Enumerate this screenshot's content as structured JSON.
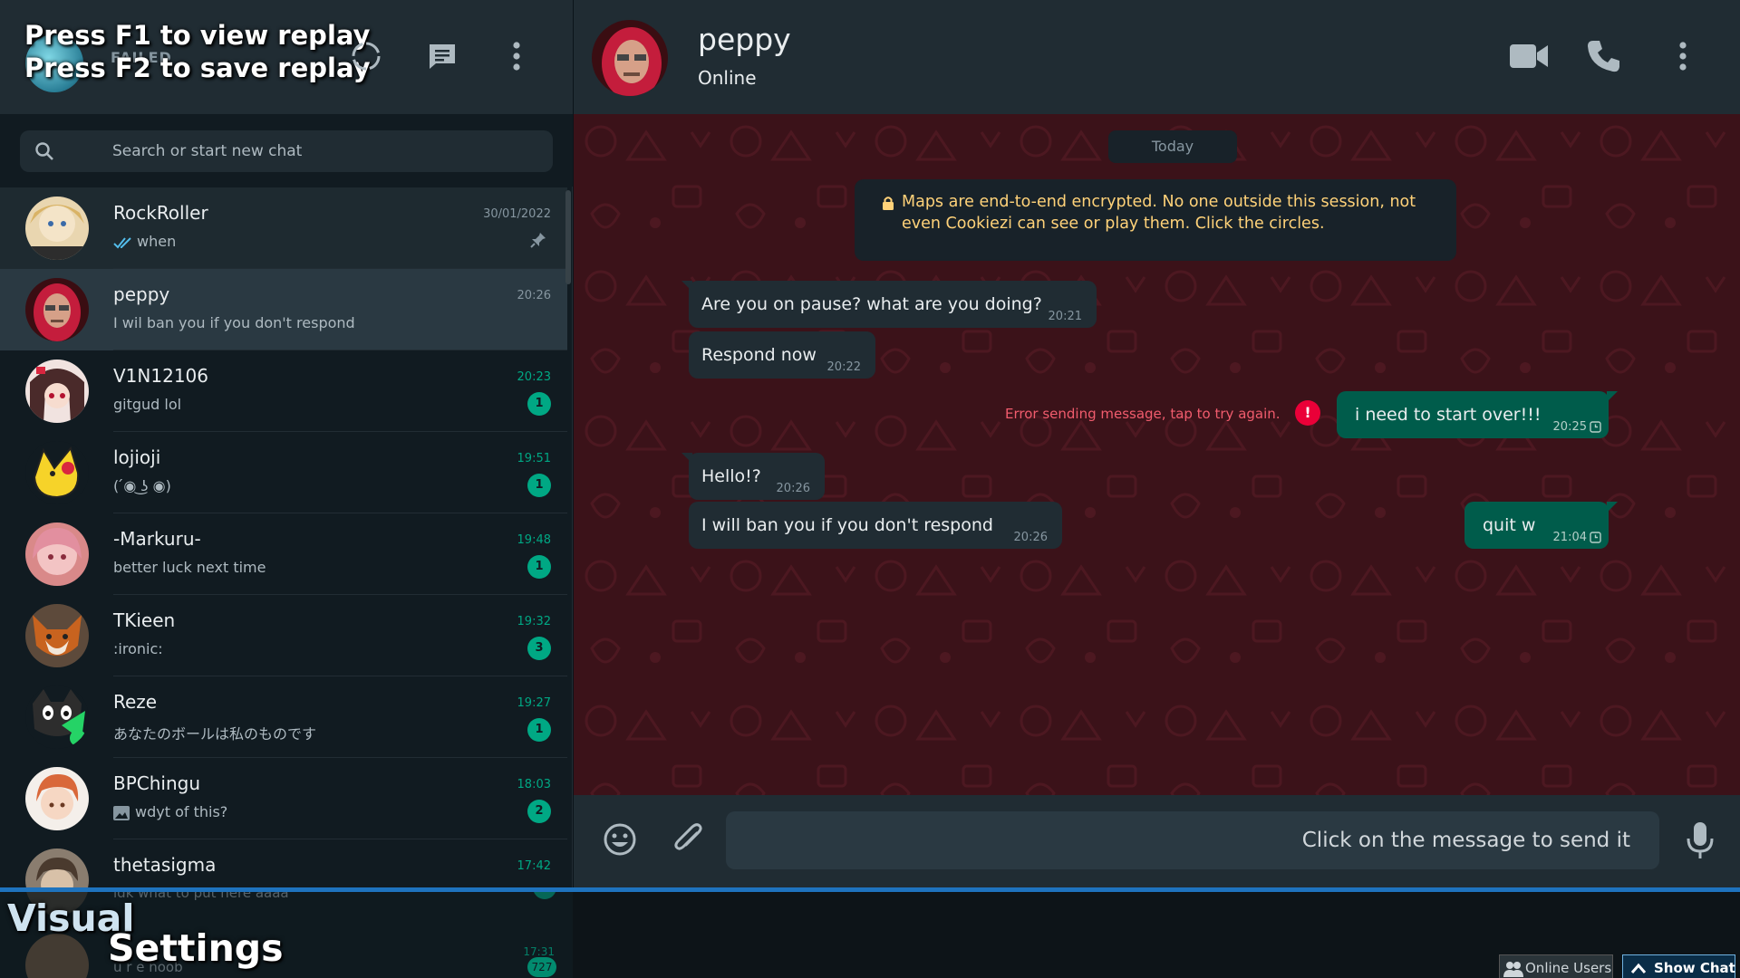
{
  "left_header": {
    "failed_label": "FAILED",
    "replay_line_1": "Press F1 to view replay",
    "replay_line_2": "Press F2 to save replay"
  },
  "search": {
    "placeholder": "Search or start new chat"
  },
  "chats": [
    {
      "name": "RockRoller",
      "time": "30/01/2022",
      "preview": "when",
      "unread": "",
      "pinned": true,
      "read": true
    },
    {
      "name": "peppy",
      "time": "20:26",
      "preview": "I wil ban you if you don't respond",
      "unread": "",
      "active": true
    },
    {
      "name": "V1N12106",
      "time": "20:23",
      "preview": "gitgud lol",
      "unread": "1"
    },
    {
      "name": "lojioji",
      "time": "19:51",
      "preview": "( ́◉ ͜ʖ ◉)",
      "unread": "1"
    },
    {
      "name": "-Markuru-",
      "time": "19:48",
      "preview": "better luck next time",
      "unread": "1"
    },
    {
      "name": "TKieen",
      "time": "19:32",
      "preview": ":ironic:",
      "unread": "3"
    },
    {
      "name": "Reze",
      "time": "19:27",
      "preview": "あなたのボールは私のものです",
      "unread": "1"
    },
    {
      "name": "BPChingu",
      "time": "18:03",
      "preview": "wdyt of this?",
      "unread": "2",
      "photo": true
    },
    {
      "name": "thetasigma",
      "time": "17:42",
      "preview": "",
      "unread": ""
    }
  ],
  "chat_header": {
    "name": "peppy",
    "status": "Online"
  },
  "conversation": {
    "date_chip": "Today",
    "encryption_note": "Maps are end-to-end encrypted. No one outside this session, not even Cookiezi can see or play them. Click the circles.",
    "messages": [
      {
        "dir": "in",
        "text": "Are you on pause? what are you doing?",
        "time": "20:21"
      },
      {
        "dir": "in",
        "text": "Respond now",
        "time": "20:22"
      },
      {
        "dir": "out",
        "text": "i need to start over!!!",
        "time": "20:25"
      },
      {
        "dir": "in",
        "text": "Hello!?",
        "time": "20:26"
      },
      {
        "dir": "in",
        "text": "I will ban you if you don't respond",
        "time": "20:26"
      },
      {
        "dir": "out",
        "text": "quit w",
        "time": "21:04"
      }
    ],
    "error_text": "Error sending message, tap to try again.",
    "error_mark": "!"
  },
  "composer": {
    "placeholder": "Click on the message to send it"
  },
  "overlay": {
    "ghost_preview": "idk what to put here aaaa",
    "ghost_time": "17:31",
    "ghost_name": "u r e noob",
    "ghost_badge": "727",
    "visual_label": "Visual",
    "settings_label": "Settings",
    "online_users": "Online Users",
    "show_chat": "Show Chat"
  },
  "colors": {
    "accent": "#00a884",
    "panel": "#202c33",
    "background": "#111b21",
    "outgoing_bubble": "#005c4b",
    "error": "#f15c6d",
    "wallpaper": "#3b1219"
  },
  "icons": [
    "status-icon",
    "new-chat-icon",
    "menu-icon",
    "search-icon",
    "video-call-icon",
    "phone-icon",
    "pin-icon",
    "lock-icon",
    "clock-icon",
    "emoji-icon",
    "attach-icon",
    "mic-icon",
    "users-icon",
    "chevron-up-icon"
  ]
}
